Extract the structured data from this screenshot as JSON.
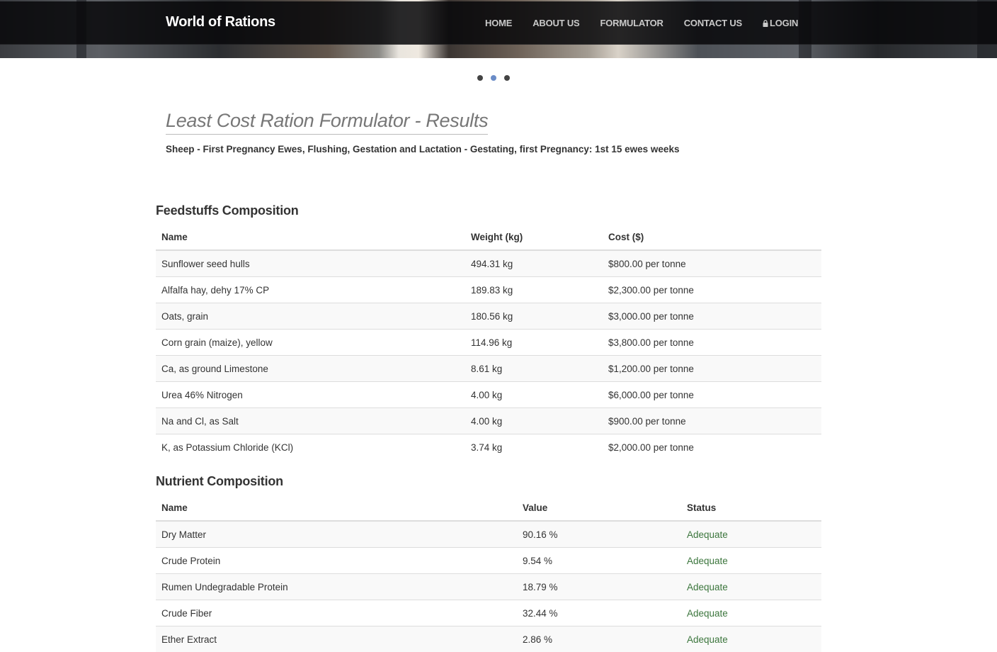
{
  "brand": "World of Rations",
  "nav": [
    "HOME",
    "ABOUT US",
    "FORMULATOR",
    "CONTACT US",
    "LOGIN"
  ],
  "carousel": {
    "slide_count": 3,
    "active_index": 1
  },
  "page_title": "Least Cost Ration Formulator - Results",
  "subtitle": "Sheep - First Pregnancy Ewes, Flushing, Gestation and Lactation - Gestating, first Pregnancy: 1st 15 ewes weeks",
  "feedstuffs": {
    "title": "Feedstuffs Composition",
    "headers": [
      "Name",
      "Weight (kg)",
      "Cost ($)"
    ],
    "rows": [
      [
        "Sunflower seed hulls",
        "494.31 kg",
        "$800.00 per tonne"
      ],
      [
        "Alfalfa hay, dehy 17% CP",
        "189.83 kg",
        "$2,300.00 per tonne"
      ],
      [
        "Oats, grain",
        "180.56 kg",
        "$3,000.00 per tonne"
      ],
      [
        "Corn grain (maize), yellow",
        "114.96 kg",
        "$3,800.00 per tonne"
      ],
      [
        "Ca, as ground Limestone",
        "8.61 kg",
        "$1,200.00 per tonne"
      ],
      [
        "Urea 46% Nitrogen",
        "4.00 kg",
        "$6,000.00 per tonne"
      ],
      [
        "Na and Cl, as Salt",
        "4.00 kg",
        "$900.00 per tonne"
      ],
      [
        "K, as Potassium Chloride (KCl)",
        "3.74 kg",
        "$2,000.00 per tonne"
      ]
    ]
  },
  "nutrients": {
    "title": "Nutrient Composition",
    "headers": [
      "Name",
      "Value",
      "Status"
    ],
    "rows": [
      [
        "Dry Matter",
        "90.16 %",
        "Adequate"
      ],
      [
        "Crude Protein",
        "9.54 %",
        "Adequate"
      ],
      [
        "Rumen Undegradable Protein",
        "18.79 %",
        "Adequate"
      ],
      [
        "Crude Fiber",
        "32.44 %",
        "Adequate"
      ],
      [
        "Ether Extract",
        "2.86 %",
        "Adequate"
      ]
    ]
  },
  "colors": {
    "status_adequate": "#3c763d",
    "active_dot": "#6a8cc7",
    "navbar": "#08080a"
  }
}
